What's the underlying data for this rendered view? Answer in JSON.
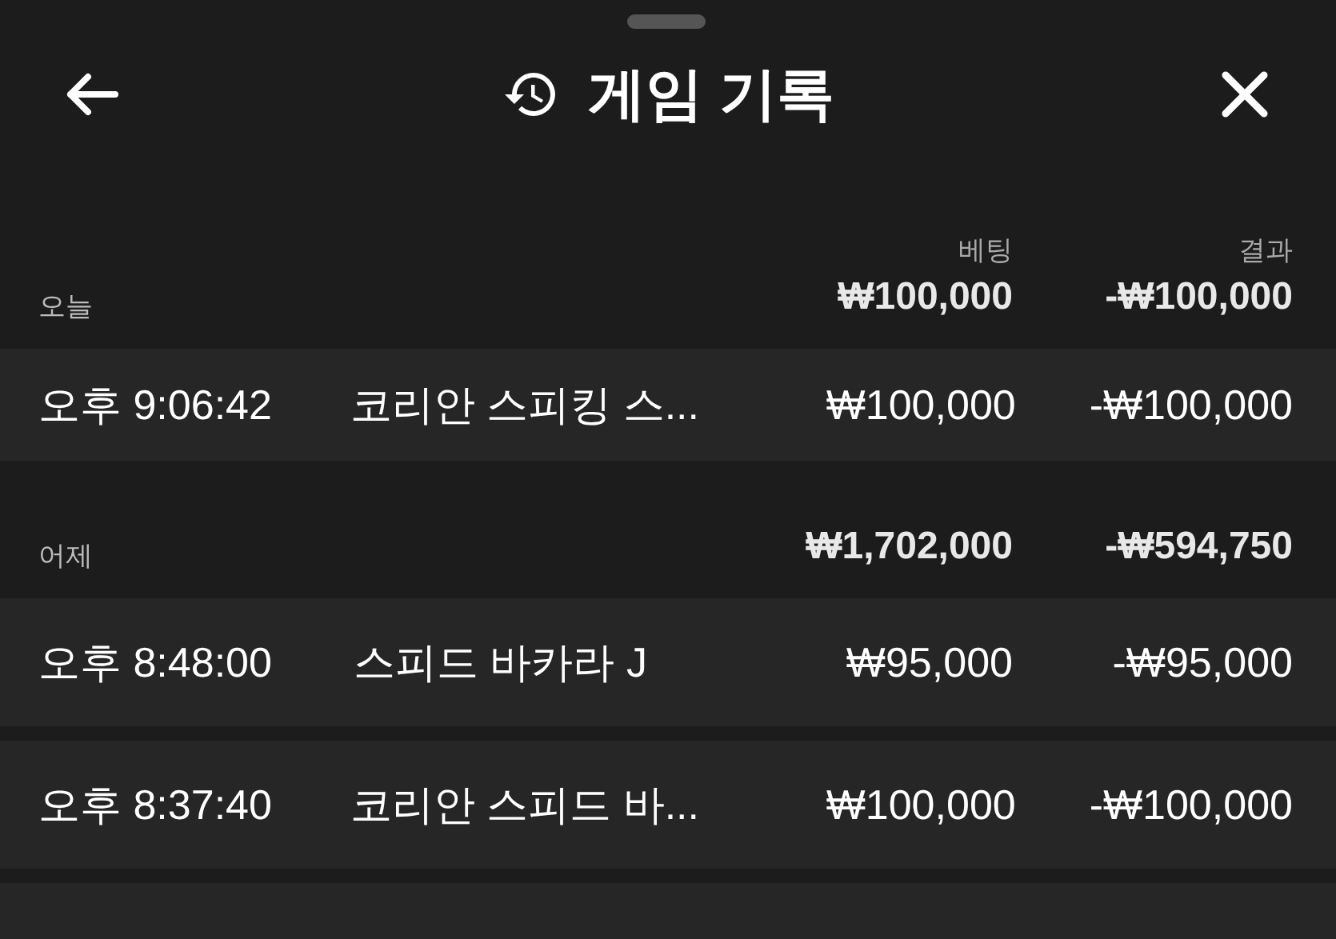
{
  "header": {
    "title": "게임 기록"
  },
  "columns": [
    "베팅",
    "결과"
  ],
  "groups": [
    {
      "label": "오늘",
      "bet_total": "₩100,000",
      "result_total": "-₩100,000",
      "rows": [
        {
          "time": "오후 9:06:42",
          "game": "코리안 스피킹 스...",
          "bet": "₩100,000",
          "result": "-₩100,000"
        }
      ]
    },
    {
      "label": "어제",
      "bet_total": "₩1,702,000",
      "result_total": "-₩594,750",
      "rows": [
        {
          "time": "오후 8:48:00",
          "game": "스피드 바카라 J",
          "bet": "₩95,000",
          "result": "-₩95,000"
        },
        {
          "time": "오후 8:37:40",
          "game": "코리안 스피드 바...",
          "bet": "₩100,000",
          "result": "-₩100,000"
        }
      ],
      "more_rows_below": true
    }
  ]
}
